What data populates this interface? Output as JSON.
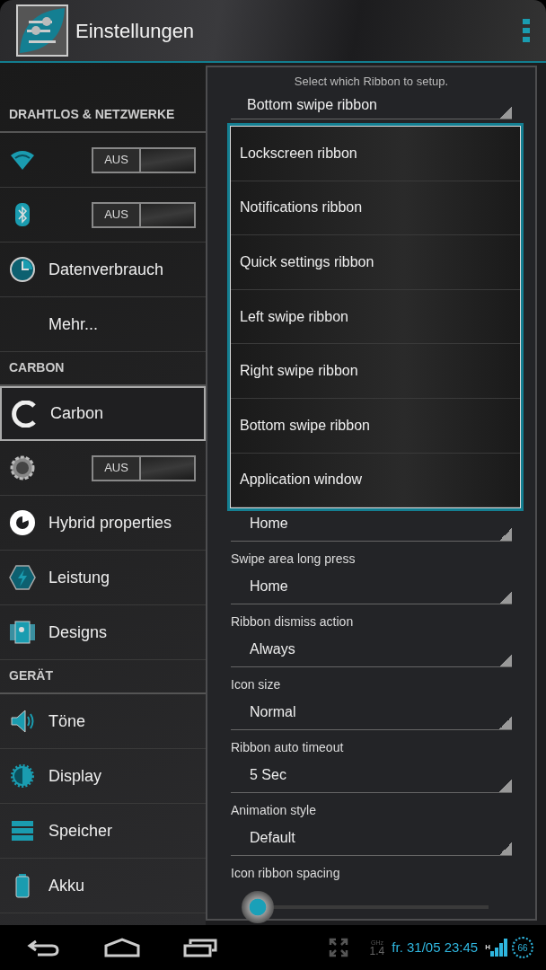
{
  "app_bar": {
    "title": "Einstellungen"
  },
  "sidebar": {
    "sections": [
      {
        "title": "DRAHTLOS & NETZWERKE",
        "items": [
          {
            "kind": "toggle",
            "switch_label": "AUS",
            "on": false,
            "selected": false
          },
          {
            "kind": "toggle",
            "switch_label": "AUS",
            "on": false,
            "selected": false
          },
          {
            "kind": "link",
            "label": "Datenverbrauch",
            "selected": false
          },
          {
            "kind": "plain",
            "label": "Mehr...",
            "selected": false
          }
        ]
      },
      {
        "title": "CARBON",
        "items": [
          {
            "kind": "link",
            "label": "Carbon",
            "selected": true
          },
          {
            "kind": "toggle",
            "switch_label": "AUS",
            "on": false,
            "selected": false
          },
          {
            "kind": "link",
            "label": "Hybrid properties",
            "selected": false
          },
          {
            "kind": "link",
            "label": "Leistung",
            "selected": false
          },
          {
            "kind": "link",
            "label": "Designs",
            "selected": false
          }
        ]
      },
      {
        "title": "GERÄT",
        "items": [
          {
            "kind": "link",
            "label": "Töne",
            "selected": false
          },
          {
            "kind": "link",
            "label": "Display",
            "selected": false
          },
          {
            "kind": "link",
            "label": "Speicher",
            "selected": false
          },
          {
            "kind": "link",
            "label": "Akku",
            "selected": false
          }
        ]
      }
    ]
  },
  "panel": {
    "caption": "Select which Ribbon to setup.",
    "ribbon_select": {
      "value": "Bottom swipe ribbon"
    },
    "fields": [
      {
        "kind": "select",
        "value": "Home"
      },
      {
        "kind": "select",
        "label": "Swipe area long press",
        "value": "Home"
      },
      {
        "kind": "select",
        "label": "Ribbon dismiss action",
        "value": "Always"
      },
      {
        "kind": "select",
        "label": "Icon size",
        "value": "Normal"
      },
      {
        "kind": "select",
        "label": "Ribbon auto timeout",
        "value": "5 Sec"
      },
      {
        "kind": "select",
        "label": "Animation style",
        "value": "Default"
      },
      {
        "kind": "slider",
        "label": "Icon ribbon spacing",
        "level": 0
      }
    ],
    "popup": {
      "options": [
        {
          "label": "Lockscreen ribbon",
          "selected": false
        },
        {
          "label": "Notifications ribbon",
          "selected": false
        },
        {
          "label": "Quick settings ribbon",
          "selected": false
        },
        {
          "label": "Left swipe ribbon",
          "selected": false
        },
        {
          "label": "Right swipe ribbon",
          "selected": false
        },
        {
          "label": "Bottom swipe ribbon",
          "selected": false
        },
        {
          "label": "Application window",
          "selected": false
        }
      ]
    }
  },
  "status_bar": {
    "cpu_unit": "GHz",
    "cpu_freq": "1.4",
    "clock": "fr. 31/05 23:45",
    "network": "H",
    "battery": "66"
  }
}
